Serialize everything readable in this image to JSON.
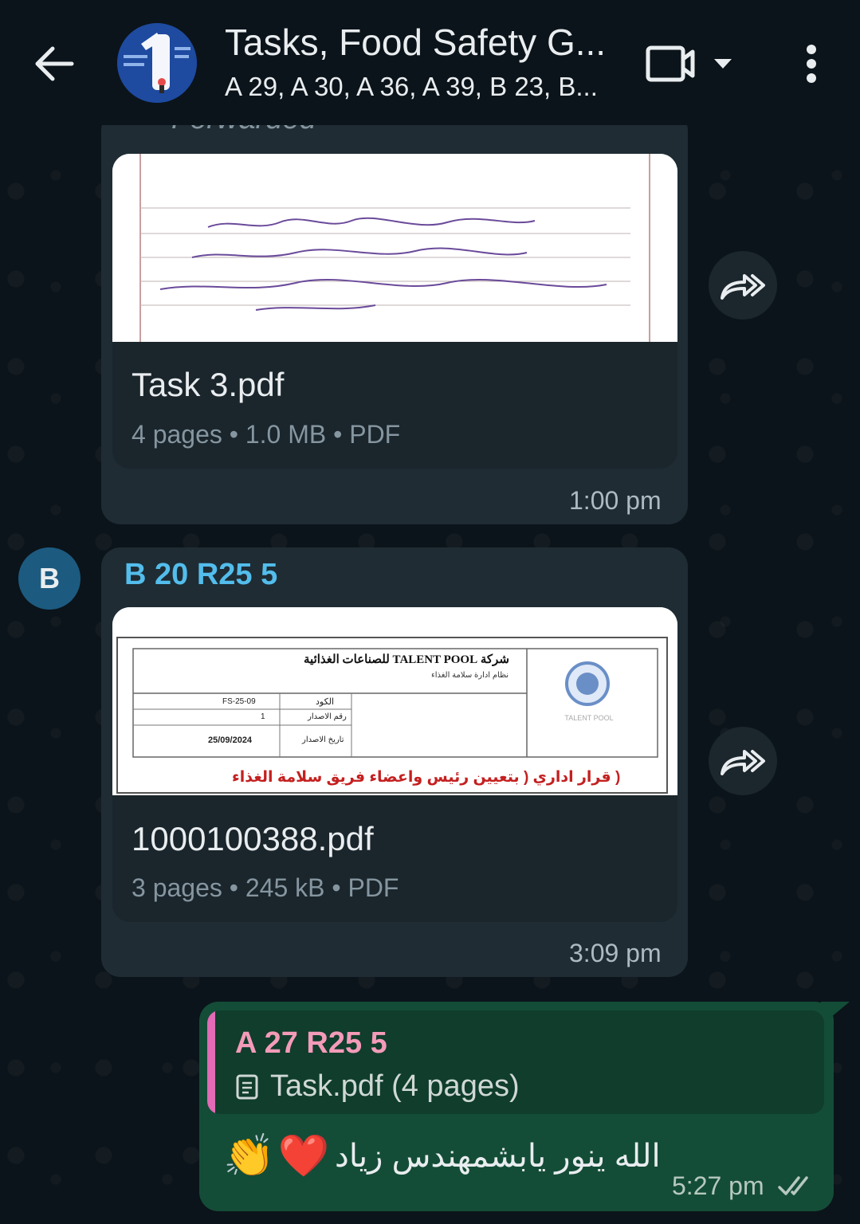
{
  "header": {
    "title": "Tasks, Food Safety G...",
    "subtitle": "A 29, A 30, A 36, A 39, B 23, B..."
  },
  "messages": [
    {
      "forwarded_label": "Forwarded",
      "document": {
        "name": "Task 3.pdf",
        "meta": "4 pages • 1.0 MB • PDF"
      },
      "time": "1:00 pm"
    },
    {
      "sender_initial": "B",
      "sender_name": "B 20 R25 5",
      "document": {
        "name": "1000100388.pdf",
        "meta": "3 pages • 245 kB • PDF"
      },
      "thumb_text": {
        "company": "شركة TALENT POOL للصناعات الغذائية",
        "system": "نظام ادارة سلامة الغذاء",
        "code_label": "الكود",
        "code_value": "FS-25-09",
        "issue_label": "رقم الاصدار",
        "issue_value": "1",
        "date_label": "تاريخ الاصدار",
        "date_value": "25/09/2024",
        "decision": "( قرار اداري ( بتعيين رئيس واعضاء فريق سلامة الغذاء"
      },
      "time": "3:09 pm"
    },
    {
      "outgoing": true,
      "quote": {
        "author": "A 27 R25 5",
        "doc": "Task.pdf (4 pages)"
      },
      "text": "الله ينور يابشمهندس زياد",
      "emojis": [
        "👏",
        "❤️"
      ],
      "time": "5:27 pm"
    }
  ],
  "colors": {
    "background": "#0b141a",
    "incoming_bubble": "#1f2c34",
    "outgoing_bubble": "#144d37",
    "sender_name": "#53bdeb",
    "quote_author": "#f49bb9"
  }
}
